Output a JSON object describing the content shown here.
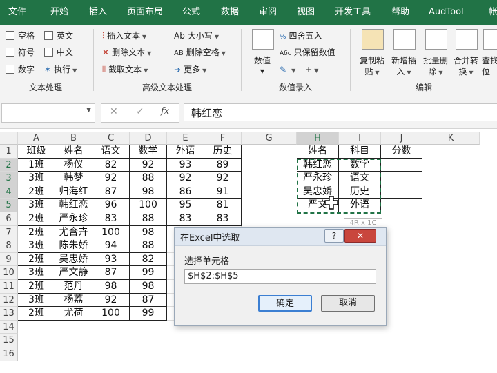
{
  "tabs": [
    "文件",
    "开始",
    "插入",
    "页面布局",
    "公式",
    "数据",
    "审阅",
    "视图",
    "开发工具",
    "帮助",
    "AudTool",
    "帐"
  ],
  "ribbon": {
    "text_proc": {
      "col1": [
        "空格",
        "符号",
        "数字"
      ],
      "col2": [
        "英文",
        "中文",
        "执行"
      ],
      "label": "文本处理"
    },
    "adv_text": {
      "col1": [
        "插入文本",
        "删除文本",
        "截取文本"
      ],
      "col2": [
        "大小写",
        "删除空格",
        "更多"
      ],
      "label": "高级文本处理"
    },
    "value_entry": {
      "big": "数值",
      "items": [
        "四舍五入",
        "只保留数值"
      ],
      "label": "数值录入"
    },
    "edit": {
      "buttons": [
        {
          "l1": "复制粘",
          "l2": "贴"
        },
        {
          "l1": "新增插",
          "l2": "入"
        },
        {
          "l1": "批量删",
          "l2": "除"
        },
        {
          "l1": "合并转",
          "l2": "换"
        },
        {
          "l1": "查找",
          "l2": "位"
        }
      ],
      "label": "编辑"
    }
  },
  "formula_bar": {
    "namebox": "",
    "fx": "fx",
    "value": "韩红恋"
  },
  "columns": [
    "A",
    "B",
    "C",
    "D",
    "E",
    "F",
    "G",
    "H",
    "I",
    "J",
    "K"
  ],
  "rows": [
    "1",
    "2",
    "3",
    "4",
    "5",
    "6",
    "7",
    "8",
    "9",
    "10",
    "11",
    "12",
    "13",
    "14",
    "15",
    "16"
  ],
  "table1": {
    "header": [
      "班级",
      "姓名",
      "语文",
      "数学",
      "外语",
      "历史"
    ],
    "rows": [
      [
        "1班",
        "杨仪",
        "82",
        "92",
        "93",
        "89"
      ],
      [
        "3班",
        "韩梦",
        "92",
        "88",
        "92",
        "92"
      ],
      [
        "2班",
        "归海红",
        "87",
        "98",
        "86",
        "91"
      ],
      [
        "3班",
        "韩红恋",
        "96",
        "100",
        "95",
        "81"
      ],
      [
        "2班",
        "严永珍",
        "83",
        "88",
        "83",
        "83"
      ],
      [
        "2班",
        "尤含卉",
        "100",
        "98",
        "",
        ""
      ],
      [
        "3班",
        "陈朱娇",
        "94",
        "88",
        "",
        ""
      ],
      [
        "2班",
        "吴忠娇",
        "93",
        "82",
        "",
        ""
      ],
      [
        "3班",
        "严文静",
        "87",
        "99",
        "",
        ""
      ],
      [
        "2班",
        "范丹",
        "98",
        "98",
        "",
        ""
      ],
      [
        "3班",
        "杨荔",
        "92",
        "87",
        "",
        ""
      ],
      [
        "2班",
        "尤荷",
        "100",
        "99",
        "",
        ""
      ]
    ]
  },
  "table2": {
    "header": [
      "姓名",
      "科目",
      "分数"
    ],
    "rows": [
      [
        "韩红恋",
        "数学",
        ""
      ],
      [
        "严永珍",
        "语文",
        ""
      ],
      [
        "吴忠娇",
        "历史",
        ""
      ],
      [
        "严文",
        "外语",
        ""
      ]
    ]
  },
  "size_tip": "4R x 1C",
  "dialog": {
    "title": "在Excel中选取",
    "help": "?",
    "close": "✕",
    "label": "选择单元格",
    "value": "$H$2:$H$5",
    "ok": "确定",
    "cancel": "取消"
  },
  "colors": {
    "accent": "#217346",
    "selection": "#217346"
  }
}
